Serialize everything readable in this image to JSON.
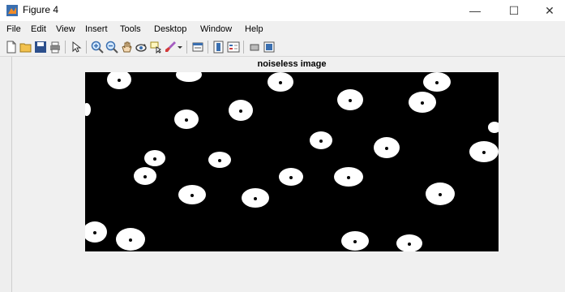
{
  "window": {
    "title": "Figure 4",
    "minimize": "—",
    "maximize": "☐",
    "close": "✕"
  },
  "menu": {
    "items": [
      "File",
      "Edit",
      "View",
      "Insert",
      "Tools",
      "Desktop",
      "Window",
      "Help"
    ]
  },
  "toolbar": {
    "icons": [
      "new-figure-icon",
      "open-file-icon",
      "save-icon",
      "print-icon",
      "pointer-icon",
      "zoom-in-icon",
      "zoom-out-icon",
      "pan-icon",
      "rotate-3d-icon",
      "data-cursor-icon",
      "brush-icon",
      "dropdown-arrow-icon",
      "link-plot-icon",
      "colorbar-icon",
      "legend-icon",
      "hide-plot-tools-icon",
      "show-plot-tools-icon"
    ]
  },
  "figure": {
    "plot_title": "noiseless image",
    "colors": {
      "background": "#000000",
      "foreground": "#ffffff"
    }
  }
}
